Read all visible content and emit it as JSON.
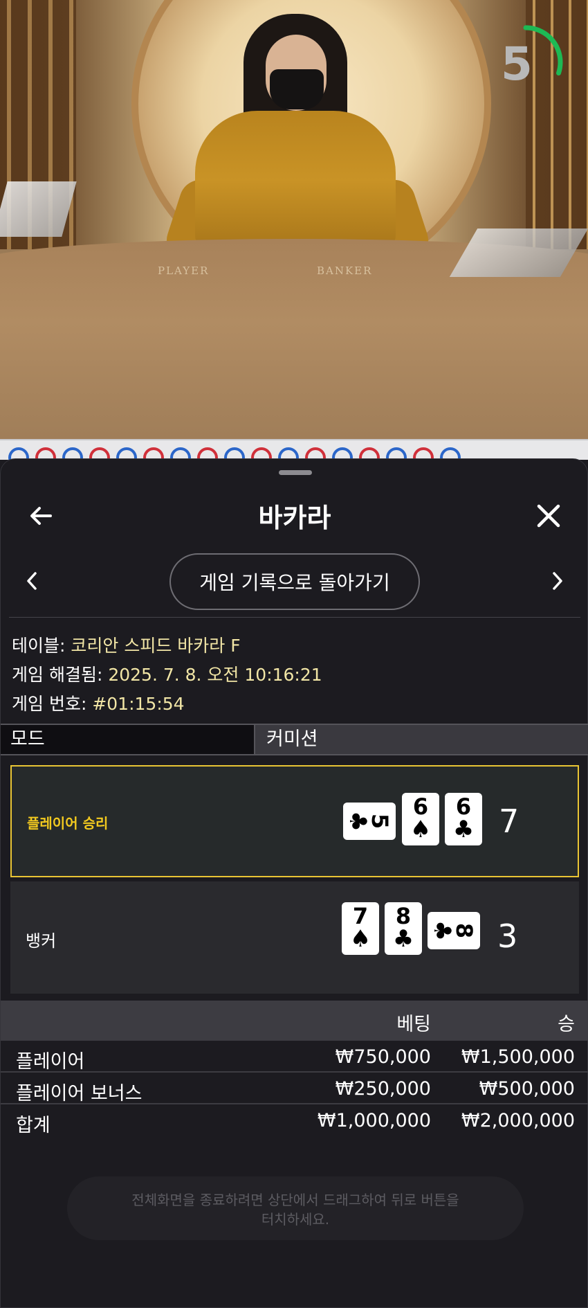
{
  "video": {
    "countdown": "5",
    "countdown_progress": 0.3,
    "table_labels": {
      "player": "PLAYER",
      "banker": "BANKER"
    }
  },
  "road": {
    "dots": [
      "P",
      "B",
      "P",
      "B",
      "P",
      "B",
      "P",
      "B",
      "P",
      "B",
      "P",
      "B",
      "P",
      "B",
      "P",
      "B",
      "P"
    ]
  },
  "header": {
    "title": "바카라",
    "back_icon": "arrow-left-icon",
    "close_icon": "close-icon"
  },
  "history_nav": {
    "back_to_history_label": "게임 기록으로 돌아가기",
    "prev_icon": "chevron-left-icon",
    "next_icon": "chevron-right-icon"
  },
  "game_info": {
    "table_key": "테이블:",
    "table_value": " 코리안 스피드 바카라 F",
    "resolved_key": "게임 해결됨:",
    "resolved_value": " 2025. 7. 8. 오전 10:16:21",
    "number_key": "게임 번호:",
    "number_value": " #01:15:54"
  },
  "mode": {
    "label": "모드",
    "value": "커미션"
  },
  "results": {
    "player": {
      "label": "플레이어 승리",
      "score": "7",
      "cards": [
        {
          "rank": "5",
          "suit": "♣",
          "orientation": "side"
        },
        {
          "rank": "6",
          "suit": "♠",
          "orientation": "up"
        },
        {
          "rank": "6",
          "suit": "♣",
          "orientation": "up"
        }
      ]
    },
    "banker": {
      "label": "뱅커",
      "score": "3",
      "cards": [
        {
          "rank": "7",
          "suit": "♠",
          "orientation": "up"
        },
        {
          "rank": "8",
          "suit": "♣",
          "orientation": "up"
        },
        {
          "rank": "8",
          "suit": "♣",
          "orientation": "side"
        }
      ]
    }
  },
  "bets": {
    "col_bet": "베팅",
    "col_win": "승",
    "rows": [
      {
        "name": "플레이어",
        "bet": "₩750,000",
        "win": "₩1,500,000"
      },
      {
        "name": "플레이어 보너스",
        "bet": "₩250,000",
        "win": "₩500,000"
      }
    ],
    "total": {
      "name": "합계",
      "bet": "₩1,000,000",
      "win": "₩2,000,000"
    }
  },
  "toast": {
    "line1": "전체화면을 종료하려면 상단에서 드래그하여 뒤로 버튼을",
    "line2": "터치하세요."
  },
  "colors": {
    "win_border": "#e9c534",
    "win_text": "#f2c91f",
    "info_text": "#f2e6a6",
    "timer_green": "#1db954",
    "road_player": "#2b66c9",
    "road_banker": "#d0303a"
  }
}
